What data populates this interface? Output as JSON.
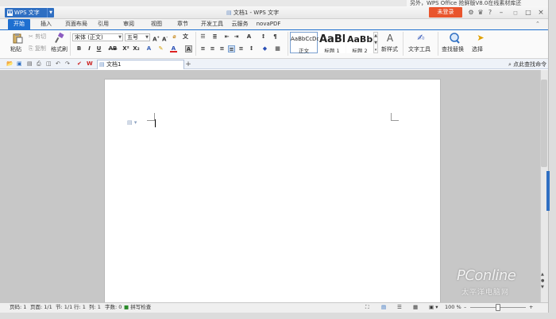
{
  "app": {
    "name": "WPS 文字",
    "document_title": "文档1 - WPS 文字",
    "login_label": "未登录",
    "background_text": "另外，WPS Office 抢鲜版V8.0在线素材库还"
  },
  "menu_tabs": [
    "开始",
    "插入",
    "页面布局",
    "引用",
    "审阅",
    "视图",
    "章节",
    "开发工具",
    "云服务",
    "novaPDF"
  ],
  "ribbon": {
    "paste": "粘贴",
    "cut": "剪切",
    "copy": "复制",
    "format_painter": "格式刷",
    "font_name": "宋体 (正文)",
    "font_size": "五号",
    "styles": [
      {
        "preview": "AaBbCcDd",
        "label": "正文"
      },
      {
        "preview": "AaBl",
        "label": "标题 1"
      },
      {
        "preview": "AaBb(",
        "label": "标题 2"
      }
    ],
    "new_style": "新样式",
    "text_tools": "文字工具",
    "find_replace": "查找替换",
    "select": "选择"
  },
  "doc_tabs": {
    "tab_name": "文档1",
    "search_placeholder": "点此查找命令"
  },
  "status": {
    "page_num": "页码: 1",
    "pages": "页面: 1/1",
    "section": "节: 1/1",
    "row": "行: 1",
    "col": "列: 1",
    "word_count": "字数: 0",
    "spell_check": "拼写检查",
    "zoom": "100 %"
  },
  "watermark": {
    "brand": "PConline",
    "sub": "太平洋电脑网"
  },
  "colors": {
    "accent": "#1e6fd0",
    "login": "#e9542c"
  }
}
